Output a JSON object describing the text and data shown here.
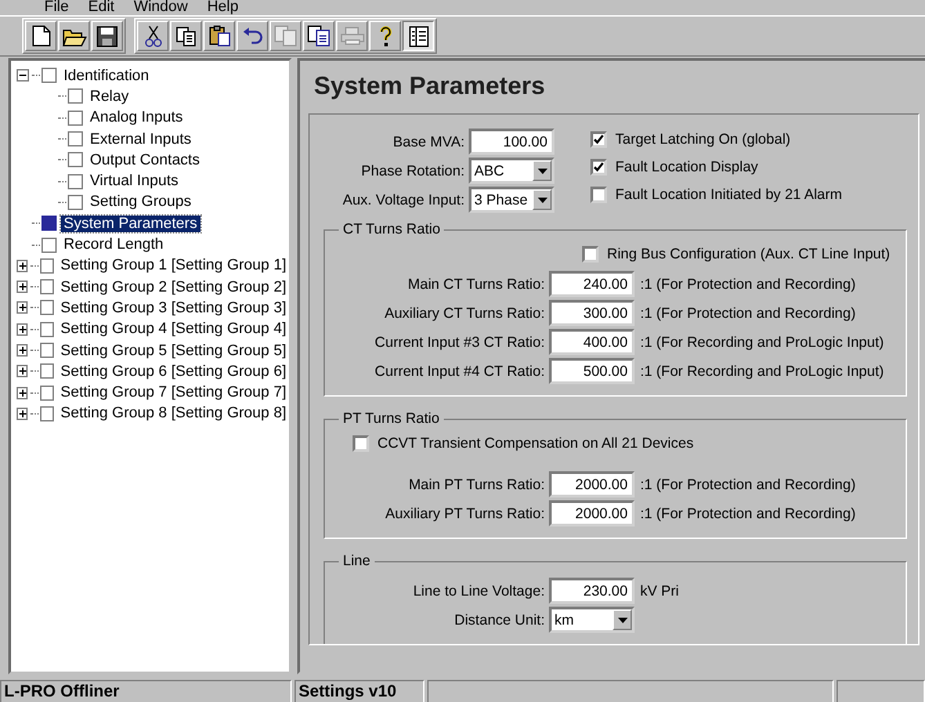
{
  "menu": [
    "File",
    "Edit",
    "Window",
    "Help"
  ],
  "toolbar": [
    {
      "kind": "new",
      "disabled": false,
      "pressed": false
    },
    {
      "kind": "open",
      "disabled": false,
      "pressed": false
    },
    {
      "kind": "save",
      "disabled": false,
      "pressed": false
    },
    {
      "kind": "cut",
      "disabled": false,
      "pressed": false
    },
    {
      "kind": "copy",
      "disabled": false,
      "pressed": false
    },
    {
      "kind": "paste",
      "disabled": false,
      "pressed": false
    },
    {
      "kind": "undo",
      "disabled": false,
      "pressed": false
    },
    {
      "kind": "compare",
      "disabled": true,
      "pressed": false
    },
    {
      "kind": "copy-settings",
      "disabled": false,
      "pressed": false
    },
    {
      "kind": "print",
      "disabled": true,
      "pressed": false
    },
    {
      "kind": "help",
      "disabled": false,
      "pressed": false
    },
    {
      "kind": "view",
      "disabled": false,
      "pressed": true
    }
  ],
  "tree": [
    {
      "label": "Identification",
      "selected": false,
      "expanded": true,
      "children": [
        {
          "label": "Relay",
          "selected": false
        },
        {
          "label": "Analog Inputs",
          "selected": false
        },
        {
          "label": "External Inputs",
          "selected": false
        },
        {
          "label": "Output Contacts",
          "selected": false
        },
        {
          "label": "Virtual Inputs",
          "selected": false
        },
        {
          "label": "Setting Groups",
          "selected": false
        }
      ]
    },
    {
      "label": "System Parameters",
      "selected": true
    },
    {
      "label": "Record Length",
      "selected": false
    },
    {
      "label": "Setting Group 1 [Setting Group 1]",
      "selected": false,
      "expanded": false
    },
    {
      "label": "Setting Group 2 [Setting Group 2]",
      "selected": false,
      "expanded": false
    },
    {
      "label": "Setting Group 3 [Setting Group 3]",
      "selected": false,
      "expanded": false
    },
    {
      "label": "Setting Group 4 [Setting Group 4]",
      "selected": false,
      "expanded": false
    },
    {
      "label": "Setting Group 5 [Setting Group 5]",
      "selected": false,
      "expanded": false
    },
    {
      "label": "Setting Group 6 [Setting Group 6]",
      "selected": false,
      "expanded": false
    },
    {
      "label": "Setting Group 7 [Setting Group 7]",
      "selected": false,
      "expanded": false
    },
    {
      "label": "Setting Group 8 [Setting Group 8]",
      "selected": false,
      "expanded": false
    }
  ],
  "page": {
    "title": "System Parameters",
    "fields": [
      {
        "label": "Base MVA:",
        "kind": "text",
        "value": "100.00"
      },
      {
        "label": "Phase Rotation:",
        "kind": "dropdown",
        "value": "ABC"
      },
      {
        "label": "Aux. Voltage Input:",
        "kind": "dropdown",
        "value": "3 Phase"
      }
    ],
    "options": [
      {
        "label": "Target Latching On (global)",
        "checked": true
      },
      {
        "label": "Fault Location Display",
        "checked": true
      },
      {
        "label": "Fault Location Initiated by 21 Alarm",
        "checked": false
      }
    ],
    "sections": [
      {
        "title": "CT Turns Ratio",
        "option": {
          "label": "Ring Bus Configuration (Aux. CT Line Input)",
          "checked": false,
          "kind": "indented"
        },
        "rows": [
          {
            "label": "Main CT Turns Ratio:",
            "kind": "text",
            "value": "240.00",
            "note": ":1 (For Protection and Recording)"
          },
          {
            "label": "Auxiliary CT Turns Ratio:",
            "kind": "text",
            "value": "300.00",
            "note": ":1 (For Protection and Recording)"
          },
          {
            "label": "Current Input #3 CT Ratio:",
            "kind": "text",
            "value": "400.00",
            "note": ":1 (For Recording and ProLogic Input)"
          },
          {
            "label": "Current Input #4 CT Ratio:",
            "kind": "text",
            "value": "500.00",
            "note": ":1 (For Recording and ProLogic Input)"
          }
        ]
      },
      {
        "title": "PT Turns Ratio",
        "option": {
          "label": "CCVT Transient Compensation on All 21 Devices",
          "checked": false,
          "kind": "left"
        },
        "rows": [
          {
            "label": "Main PT Turns Ratio:",
            "kind": "text",
            "value": "2000.00",
            "note": ":1 (For Protection and Recording)"
          },
          {
            "label": "Auxiliary PT Turns Ratio:",
            "kind": "text",
            "value": "2000.00",
            "note": ":1 (For Protection and Recording)"
          }
        ]
      },
      {
        "title": "Line",
        "rows": [
          {
            "label": "Line to Line Voltage:",
            "kind": "text",
            "value": "230.00",
            "note": "kV Pri"
          },
          {
            "label": "Distance Unit:",
            "kind": "dropdown",
            "value": "km"
          }
        ]
      }
    ]
  },
  "status_bar": [
    "L-PRO Offliner",
    "Settings v10"
  ]
}
